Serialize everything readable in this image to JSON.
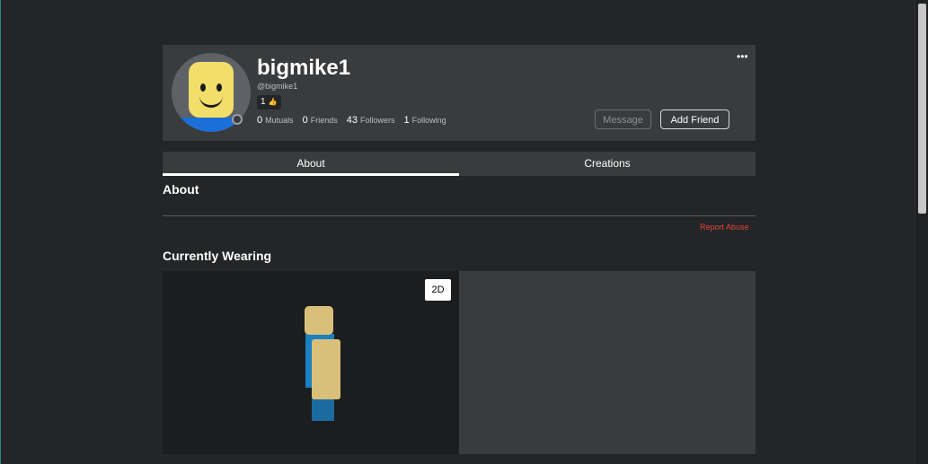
{
  "profile": {
    "display_name": "bigmike1",
    "username": "@bigmike1",
    "badge_count": "1",
    "stats": [
      {
        "value": "0",
        "label": "Mutuals"
      },
      {
        "value": "0",
        "label": "Friends"
      },
      {
        "value": "43",
        "label": "Followers"
      },
      {
        "value": "1",
        "label": "Following"
      }
    ],
    "message_label": "Message",
    "add_friend_label": "Add Friend",
    "more_icon": "•••"
  },
  "tabs": [
    {
      "label": "About",
      "active": true
    },
    {
      "label": "Creations",
      "active": false
    }
  ],
  "about": {
    "title": "About",
    "report_label": "Report Abuse"
  },
  "wearing": {
    "title": "Currently Wearing",
    "toggle_label": "2D"
  },
  "colors": {
    "background": "#232527",
    "card": "#393b3d",
    "report": "#e2453c"
  }
}
